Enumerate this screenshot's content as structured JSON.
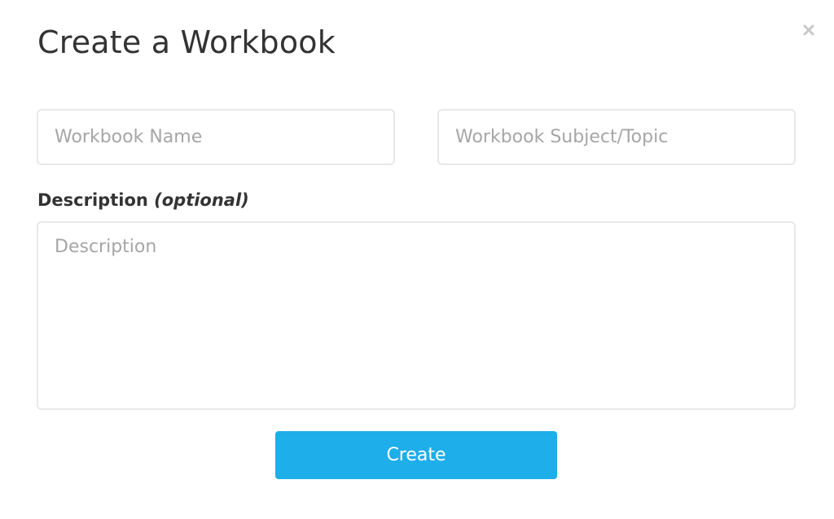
{
  "modal": {
    "title": "Create a Workbook",
    "close_icon": "close-icon"
  },
  "form": {
    "name_placeholder": "Workbook Name",
    "name_value": "",
    "subject_placeholder": "Workbook Subject/Topic",
    "subject_value": "",
    "description_label": "Description",
    "description_optional": "(optional)",
    "description_placeholder": "Description",
    "description_value": ""
  },
  "actions": {
    "create_label": "Create"
  },
  "colors": {
    "accent": "#1eaee9",
    "text": "#333333",
    "placeholder": "#a6a6a6",
    "border": "#e8e8e8",
    "close_icon": "#c8c8c8"
  }
}
